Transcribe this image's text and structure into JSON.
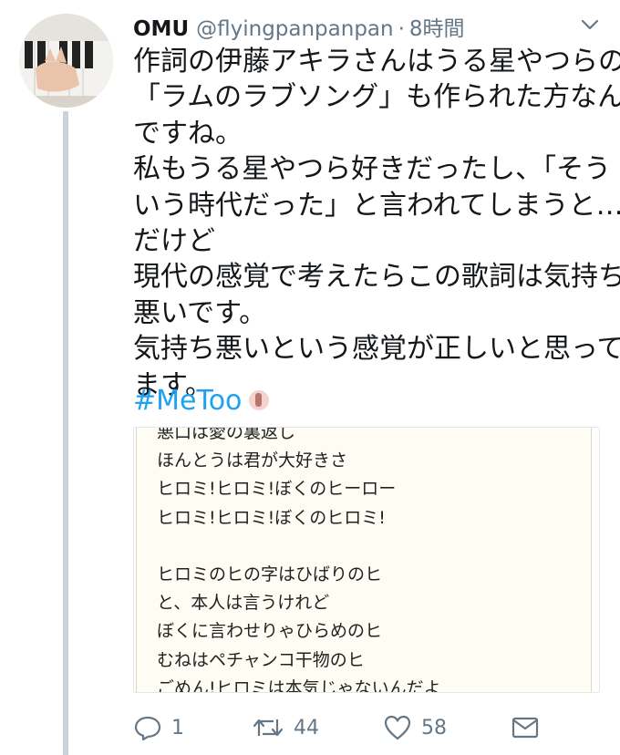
{
  "tweet": {
    "display_name": "OMU",
    "handle": "@flyingpanpanpan",
    "separator": "·",
    "time": "8時間",
    "text_lines": [
      "作詞の伊藤アキラさんはうる星やつらの",
      "「ラムのラブソング」も作られた方なん",
      "ですね。",
      "私もうる星やつら好きだったし、「そう",
      "いう時代だった」と言われてしまうと…",
      "だけど",
      "現代の感覚で考えたらこの歌詞は気持ち",
      "悪いです。",
      "気持ち悪いという感覚が正しいと思って",
      "ます。"
    ],
    "hashtag": "#MeToo",
    "lyrics_lines": [
      "悪口は愛の裏返し",
      "ほんとうは君が大好きさ",
      "ヒロミ!ヒロミ!ぼくのヒーロー",
      "ヒロミ!ヒロミ!ぼくのヒロミ!",
      "",
      "ヒロミのヒの字はひばりのヒ",
      "と、本人は言うけれど",
      "ぼくに言わせりゃひらめのヒ",
      "むねはペチャンコ干物のヒ",
      "ごめん!ヒロミは本気じゃないんだよ"
    ],
    "actions": {
      "reply_count": "1",
      "retweet_count": "44",
      "like_count": "58"
    }
  },
  "icons": {
    "avatar": "avatar-photo",
    "menu": "chevron-down-icon",
    "reply": "reply-icon",
    "retweet": "retweet-icon",
    "like": "heart-icon",
    "dm": "envelope-icon",
    "emoji": "raised-hand-emoji"
  },
  "colors": {
    "link": "#1da1f2",
    "muted": "#657786",
    "thread_line": "#c9d3da"
  }
}
